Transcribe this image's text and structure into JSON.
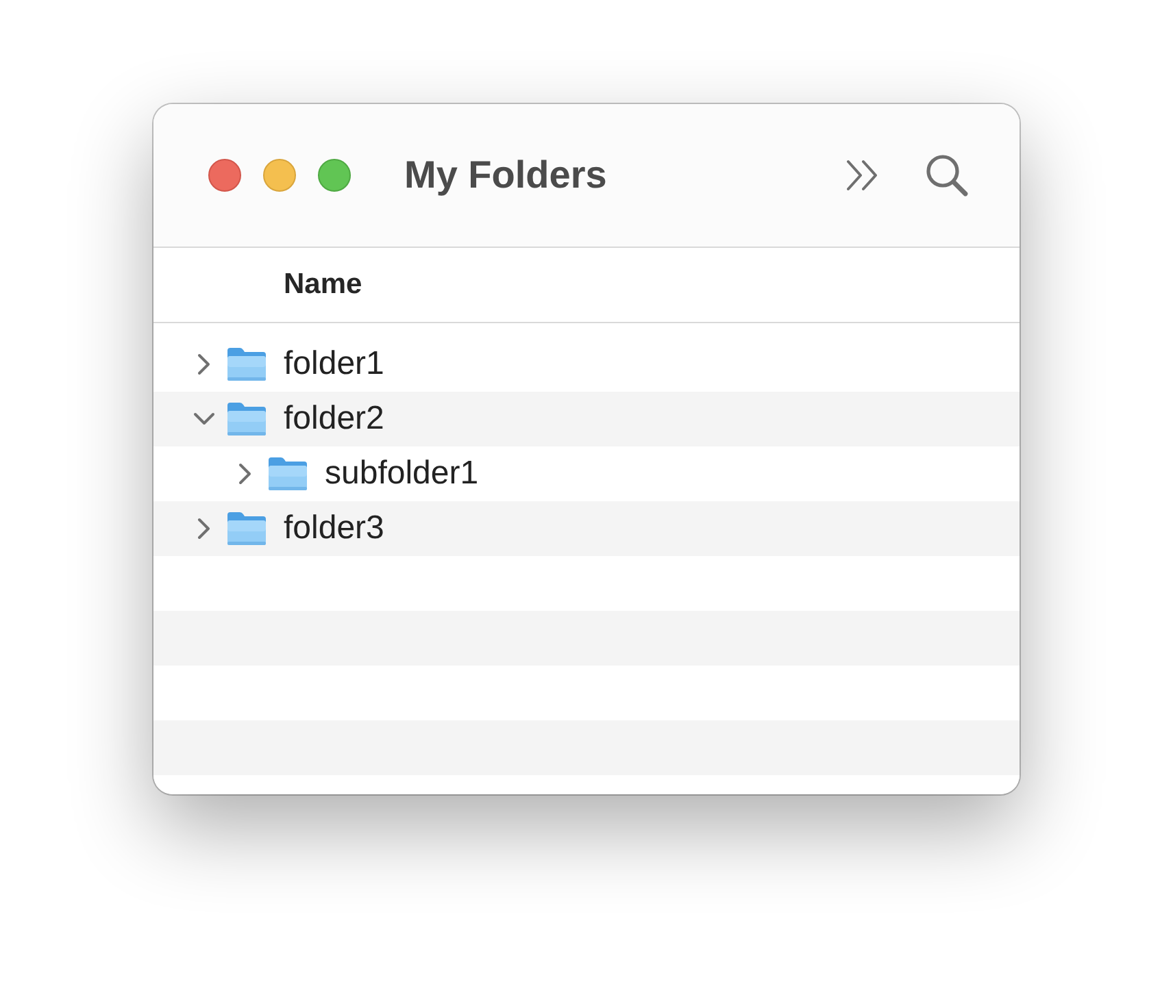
{
  "window": {
    "title": "My Folders"
  },
  "table": {
    "columns": [
      "Name"
    ]
  },
  "tree": [
    {
      "name": "folder1",
      "expanded": false,
      "selected": false
    },
    {
      "name": "folder2",
      "expanded": true,
      "selected": false,
      "children": [
        {
          "name": "subfolder1",
          "expanded": false,
          "selected": false
        }
      ]
    },
    {
      "name": "folder3",
      "expanded": false,
      "selected": false
    }
  ]
}
